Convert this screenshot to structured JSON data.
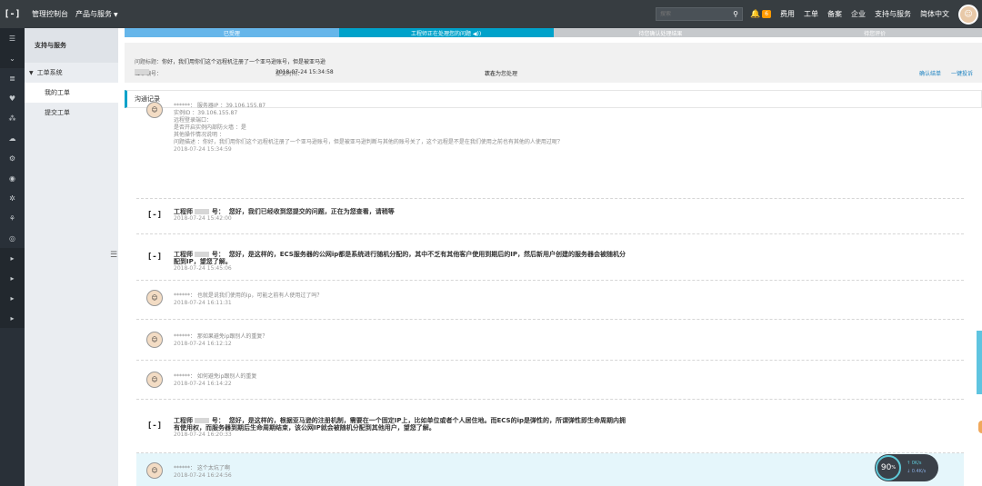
{
  "topbar": {
    "logo": "[-]",
    "console": "管理控制台",
    "products": "产品与服务",
    "search_placeholder": "搜索",
    "notification_count": "6",
    "items": [
      "费用",
      "工单",
      "备案",
      "企业",
      "支持与服务",
      "简体中文"
    ]
  },
  "rail": {
    "icons": [
      "menu-icon",
      "chevron-icon",
      "list-icon",
      "heart-icon",
      "network-icon",
      "cloud-icon",
      "gear-icon",
      "eye-icon",
      "cross-icon",
      "tree-icon",
      "globe-icon",
      "arrow-icon",
      "arrow-icon",
      "arrow-icon",
      "arrow-icon"
    ]
  },
  "sidebar": {
    "title": "支持与服务",
    "group": "工单系统",
    "items": [
      {
        "label": "我的工单",
        "active": true
      },
      {
        "label": "提交工单",
        "active": false
      }
    ]
  },
  "steps": [
    {
      "label": "已受理",
      "state": "done"
    },
    {
      "label": "工程师正在处理您的问题 ◀))",
      "state": "active"
    },
    {
      "label": "待您确认处理结果",
      "state": "todo"
    },
    {
      "label": "待您评价",
      "state": "todo"
    }
  ],
  "ticket": {
    "title_label": "问题标题：",
    "title_value": "你好，我们用你们这个远程机注册了一个亚马逊账号，但是被亚马逊",
    "id_label": "工单编号：",
    "id_value": "GJ",
    "submit_label": "提交时间：",
    "submit_value": "2018-07-24 15:34:58",
    "status_label": "状态：",
    "status_value": "正在为您处理",
    "confirm_action": "确认结单",
    "complain_action": "一键投诉"
  },
  "comm_header": "沟通记录",
  "messages": [
    {
      "type": "user",
      "lines": [
        "******：  服务器IP ：39.106.155.87",
        "实例ID ：39.106.155.87",
        "远程登录端口：",
        "是否开启实例内部防火墙 ：是",
        "其他操作情况说明 ：",
        "问题描述 ：你好，我们用你们这个远程机注册了一个亚马逊账号，但是被亚马逊判断与其他的账号关了，这个远程是不是在我们使用之前也有其他的人使用过呢？"
      ],
      "time": "2018-07-24 15:34:59"
    },
    {
      "type": "engineer",
      "name_prefix": "工程师",
      "name_suffix": "号：",
      "lines": [
        "您好，我们已经收到您提交的问题，正在为您查看，请稍等"
      ],
      "time": "2018-07-24 15:42:00"
    },
    {
      "type": "engineer",
      "name_prefix": "工程师",
      "name_suffix": "号：",
      "lines": [
        "您好，是这样的，ECS服务器的公网ip都是系统进行随机分配的，其中不乏有其他客户使用到期后的IP，然后新用户创建的服务器会被随机分",
        "配到IP，望您了解。"
      ],
      "time": "2018-07-24 15:45:06"
    },
    {
      "type": "user",
      "lines": [
        "******：  也就是说我们使用的ip，可能之前有人使用过了吗？"
      ],
      "time": "2018-07-24 16:11:31"
    },
    {
      "type": "user",
      "lines": [
        "******：  那如果避免ip跟别人的重复？"
      ],
      "time": "2018-07-24 16:12:12"
    },
    {
      "type": "user",
      "lines": [
        "******：  如何避免ip跟别人的重复"
      ],
      "time": "2018-07-24 16:14:22"
    },
    {
      "type": "engineer",
      "name_prefix": "工程师",
      "name_suffix": "号：",
      "lines": [
        "您好，是这样的，根据亚马逊的注册机制，需要在一个固定IP上，比如单位或者个人居住地。而ECS的ip是弹性的，所谓弹性即生命周期内拥",
        "有使用权，而服务器到期后生命周期结束，该公网IP就会被随机分配到其他用户，望您了解。"
      ],
      "time": "2018-07-24 16:20:33"
    },
    {
      "type": "user",
      "highlight": true,
      "lines": [
        "******：  这个太坑了啊"
      ],
      "time": "2018-07-24 16:24:56"
    }
  ],
  "speed_widget": {
    "percent": "90",
    "percent_unit": "%",
    "up": "↑ 0K/s",
    "down": "↓ 0.4K/s"
  }
}
